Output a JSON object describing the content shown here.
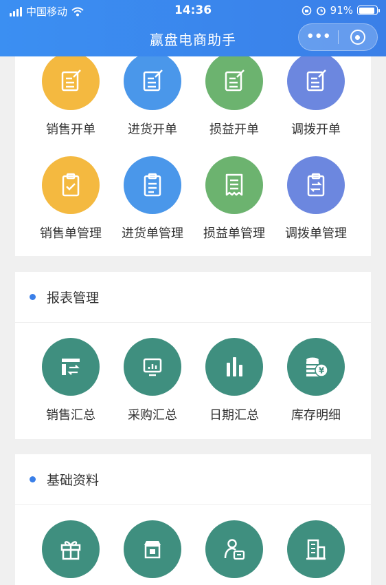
{
  "status_bar": {
    "carrier": "中国移动",
    "time": "14:36",
    "battery": "91%",
    "battery_level": 0.91
  },
  "header": {
    "title": "赢盘电商助手"
  },
  "orders": {
    "row1": [
      "销售开单",
      "进货开单",
      "损益开单",
      "调拨开单"
    ],
    "row2": [
      "销售单管理",
      "进货单管理",
      "损益单管理",
      "调拨单管理"
    ]
  },
  "reports": {
    "title": "报表管理",
    "items": [
      "销售汇总",
      "采购汇总",
      "日期汇总",
      "库存明细"
    ]
  },
  "basics": {
    "title": "基础资料"
  },
  "colors": {
    "header": "#3a7fe8",
    "yellow": "#f4b940",
    "blue": "#4a97ea",
    "green": "#6cb36f",
    "indigo": "#6c87df",
    "teal": "#3f8f7f"
  }
}
